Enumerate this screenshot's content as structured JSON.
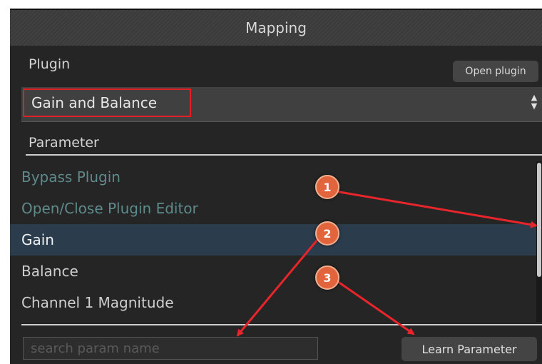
{
  "window": {
    "title": "Mapping"
  },
  "plugin_section": {
    "label": "Plugin",
    "open_plugin_button": "Open plugin",
    "selected_plugin": "Gain and Balance"
  },
  "parameter_section": {
    "label": "Parameter",
    "items": [
      {
        "label": "Bypass Plugin",
        "state": "dim"
      },
      {
        "label": "Open/Close Plugin Editor",
        "state": "dim"
      },
      {
        "label": "Gain",
        "state": "selected"
      },
      {
        "label": "Balance",
        "state": "normal"
      },
      {
        "label": "Channel 1 Magnitude",
        "state": "normal"
      }
    ]
  },
  "search": {
    "placeholder": "search param name",
    "value": ""
  },
  "learn_button": "Learn Parameter",
  "annotations": {
    "badges": [
      "1",
      "2",
      "3"
    ],
    "badge_color": "#e2643c",
    "arrow_color": "#e8252b",
    "highlight_color": "#e21f26"
  },
  "colors": {
    "panel_bg": "#252525",
    "selected_row_bg": "#2b3c4c",
    "dim_text": "#5f8a8a"
  }
}
